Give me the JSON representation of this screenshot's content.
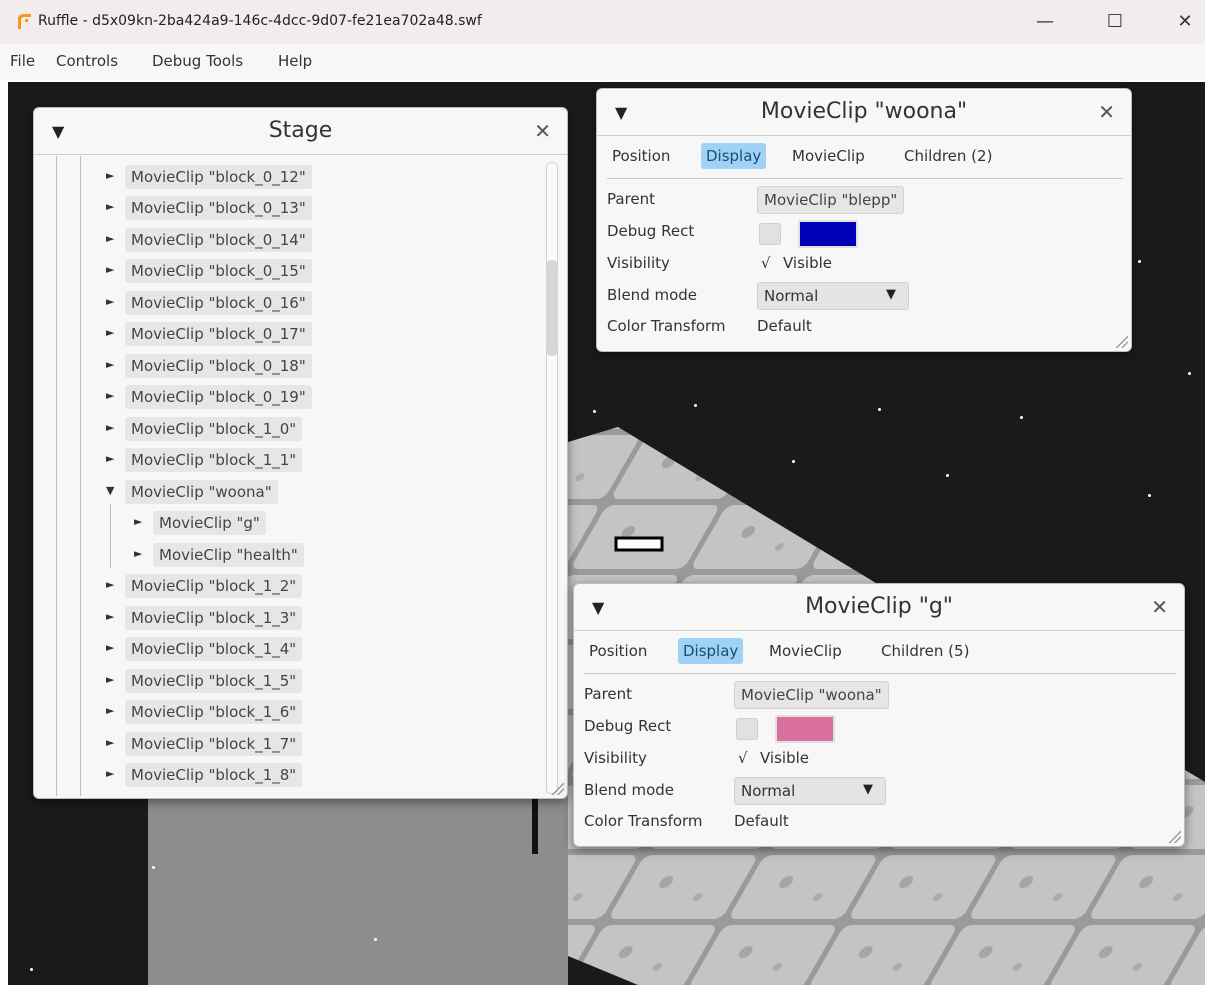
{
  "window": {
    "title": "Ruffle - d5x09kn-2ba424a9-146c-4dcc-9d07-fe21ea702a48.swf",
    "minimize_glyph": "—",
    "maximize_glyph": "☐",
    "close_glyph": "✕",
    "accent": "#f39a1e"
  },
  "menubar": {
    "items": [
      "File",
      "Controls",
      "Debug Tools",
      "Help"
    ]
  },
  "stage_panel": {
    "title": "Stage",
    "collapse_glyph": "▼",
    "close_glyph": "✕",
    "rows": [
      {
        "label": "MovieClip \"block_0_12\"",
        "arrow": "►"
      },
      {
        "label": "MovieClip \"block_0_13\"",
        "arrow": "►"
      },
      {
        "label": "MovieClip \"block_0_14\"",
        "arrow": "►"
      },
      {
        "label": "MovieClip \"block_0_15\"",
        "arrow": "►"
      },
      {
        "label": "MovieClip \"block_0_16\"",
        "arrow": "►"
      },
      {
        "label": "MovieClip \"block_0_17\"",
        "arrow": "►"
      },
      {
        "label": "MovieClip \"block_0_18\"",
        "arrow": "►"
      },
      {
        "label": "MovieClip \"block_0_19\"",
        "arrow": "►"
      },
      {
        "label": "MovieClip \"block_1_0\"",
        "arrow": "►"
      },
      {
        "label": "MovieClip \"block_1_1\"",
        "arrow": "►"
      },
      {
        "label": "MovieClip \"woona\"",
        "arrow": "▼"
      },
      {
        "label": "MovieClip \"g\"",
        "arrow": "►"
      },
      {
        "label": "MovieClip \"health\"",
        "arrow": "►"
      },
      {
        "label": "MovieClip \"block_1_2\"",
        "arrow": "►"
      },
      {
        "label": "MovieClip \"block_1_3\"",
        "arrow": "►"
      },
      {
        "label": "MovieClip \"block_1_4\"",
        "arrow": "►"
      },
      {
        "label": "MovieClip \"block_1_5\"",
        "arrow": "►"
      },
      {
        "label": "MovieClip \"block_1_6\"",
        "arrow": "►"
      },
      {
        "label": "MovieClip \"block_1_7\"",
        "arrow": "►"
      },
      {
        "label": "MovieClip \"block_1_8\"",
        "arrow": "►"
      }
    ]
  },
  "woona_panel": {
    "title": "MovieClip \"woona\"",
    "collapse_glyph": "▼",
    "close_glyph": "✕",
    "tabs": [
      "Position",
      "Display",
      "MovieClip",
      "Children (2)"
    ],
    "active_tab": "Display",
    "labels": {
      "parent": "Parent",
      "debug_rect": "Debug Rect",
      "visibility": "Visibility",
      "blend_mode": "Blend mode",
      "color_transform": "Color Transform"
    },
    "parent_value": "MovieClip \"blepp\"",
    "debug_rect_color": "#0000b8",
    "visible_check": "√",
    "visible_label": "Visible",
    "blend_mode_value": "Normal",
    "dropdown_glyph": "▼",
    "color_transform_value": "Default"
  },
  "g_panel": {
    "title": "MovieClip \"g\"",
    "collapse_glyph": "▼",
    "close_glyph": "✕",
    "tabs": [
      "Position",
      "Display",
      "MovieClip",
      "Children (5)"
    ],
    "active_tab": "Display",
    "labels": {
      "parent": "Parent",
      "debug_rect": "Debug Rect",
      "visibility": "Visibility",
      "blend_mode": "Blend mode",
      "color_transform": "Color Transform"
    },
    "parent_value": "MovieClip \"woona\"",
    "debug_rect_color": "#d9709e",
    "visible_check": "√",
    "visible_label": "Visible",
    "blend_mode_value": "Normal",
    "dropdown_glyph": "▼",
    "color_transform_value": "Default"
  }
}
